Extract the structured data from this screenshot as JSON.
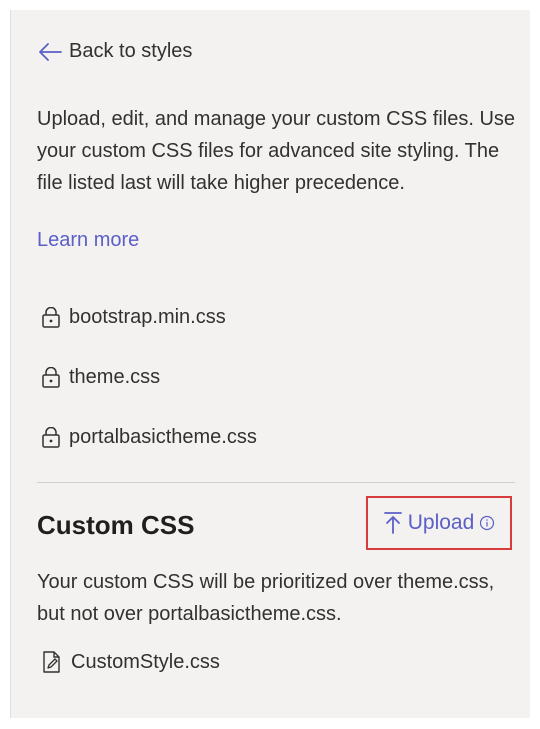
{
  "back_link": {
    "label": "Back to styles",
    "icon": "arrow-left-icon"
  },
  "description": "Upload, edit, and manage your custom CSS files. Use your custom CSS files for advanced site styling. The file listed last will take higher precedence.",
  "learn_more": "Learn more",
  "locked_files": [
    {
      "name": "bootstrap.min.css",
      "icon": "lock-icon"
    },
    {
      "name": "theme.css",
      "icon": "lock-icon"
    },
    {
      "name": "portalbasictheme.css",
      "icon": "lock-icon"
    }
  ],
  "custom_section": {
    "title": "Custom CSS",
    "upload_label": "Upload",
    "upload_icon": "upload-arrow-icon",
    "info_icon": "info-icon",
    "note": "Your custom CSS will be prioritized over theme.css, but not over portalbasictheme.css.",
    "files": [
      {
        "name": "CustomStyle.css",
        "icon": "file-edit-icon"
      }
    ]
  },
  "colors": {
    "link": "#5b5fc7",
    "highlight_border": "#d83b3b",
    "panel_bg": "#f3f2f1"
  }
}
